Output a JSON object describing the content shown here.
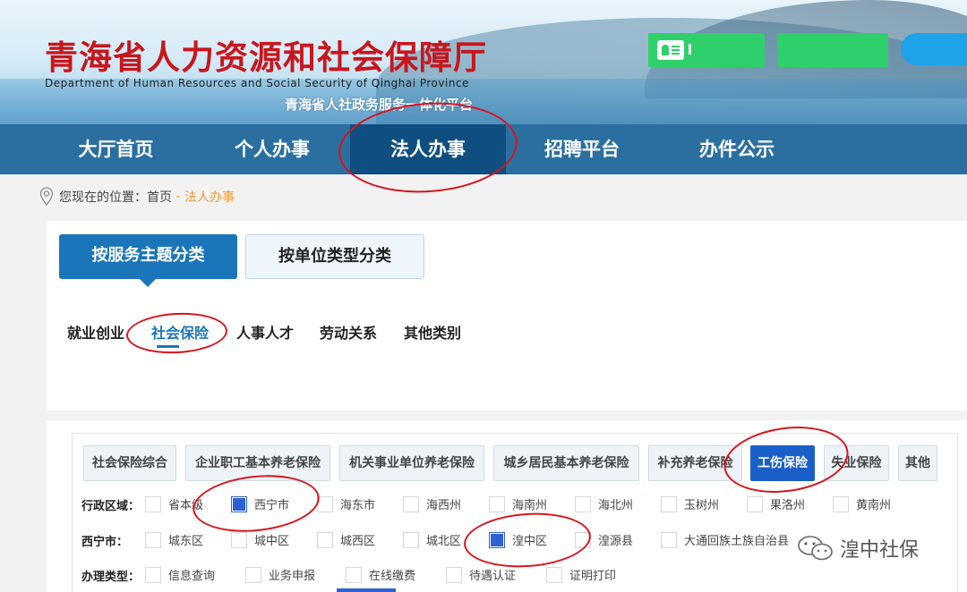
{
  "header": {
    "title": "青海省人力资源和社会保障厅",
    "subtitle_en": "Department of Human Resources and Social Security of Qinghai Province",
    "platform": "青海省人社政务服务一体化平台"
  },
  "nav": {
    "items": [
      "大厅首页",
      "个人办事",
      "法人办事",
      "招聘平台",
      "办件公示"
    ],
    "active": "法人办事"
  },
  "breadcrumb": {
    "prefix": "您现在的位置：",
    "home": "首页",
    "sep": " - ",
    "current": "法人办事"
  },
  "classify_tabs": [
    "按服务主题分类",
    "按单位类型分类"
  ],
  "categories": [
    "就业创业",
    "社会保险",
    "人事人才",
    "劳动关系",
    "其他类别"
  ],
  "service_tabs": [
    "社会保险综合",
    "企业职工基本养老保险",
    "机关事业单位养老保险",
    "城乡居民基本养老保险",
    "补充养老保险",
    "工伤保险",
    "失业保险",
    "其他"
  ],
  "filters": {
    "region": {
      "label": "行政区域：",
      "options": [
        "省本级",
        "西宁市",
        "海东市",
        "海西州",
        "海南州",
        "海北州",
        "玉树州",
        "果洛州",
        "黄南州"
      ]
    },
    "xining": {
      "label": "西宁市：",
      "options": [
        "城东区",
        "城中区",
        "城西区",
        "城北区",
        "湟中区",
        "湟源县",
        "大通回族土族自治县"
      ]
    },
    "type": {
      "label": "办理类型：",
      "options": [
        "信息查询",
        "业务申报",
        "在线缴费",
        "待遇认证",
        "证明打印"
      ]
    }
  },
  "watermark": "湟中社保",
  "colors": {
    "nav_bg": "#2b6fa1",
    "nav_active": "#0f4e80",
    "title_red": "#c8161d",
    "accent_blue": "#1a76b8",
    "checked_blue": "#2f61d6",
    "annotation_red": "#d8141c",
    "header_green": "#2fcf6b"
  }
}
